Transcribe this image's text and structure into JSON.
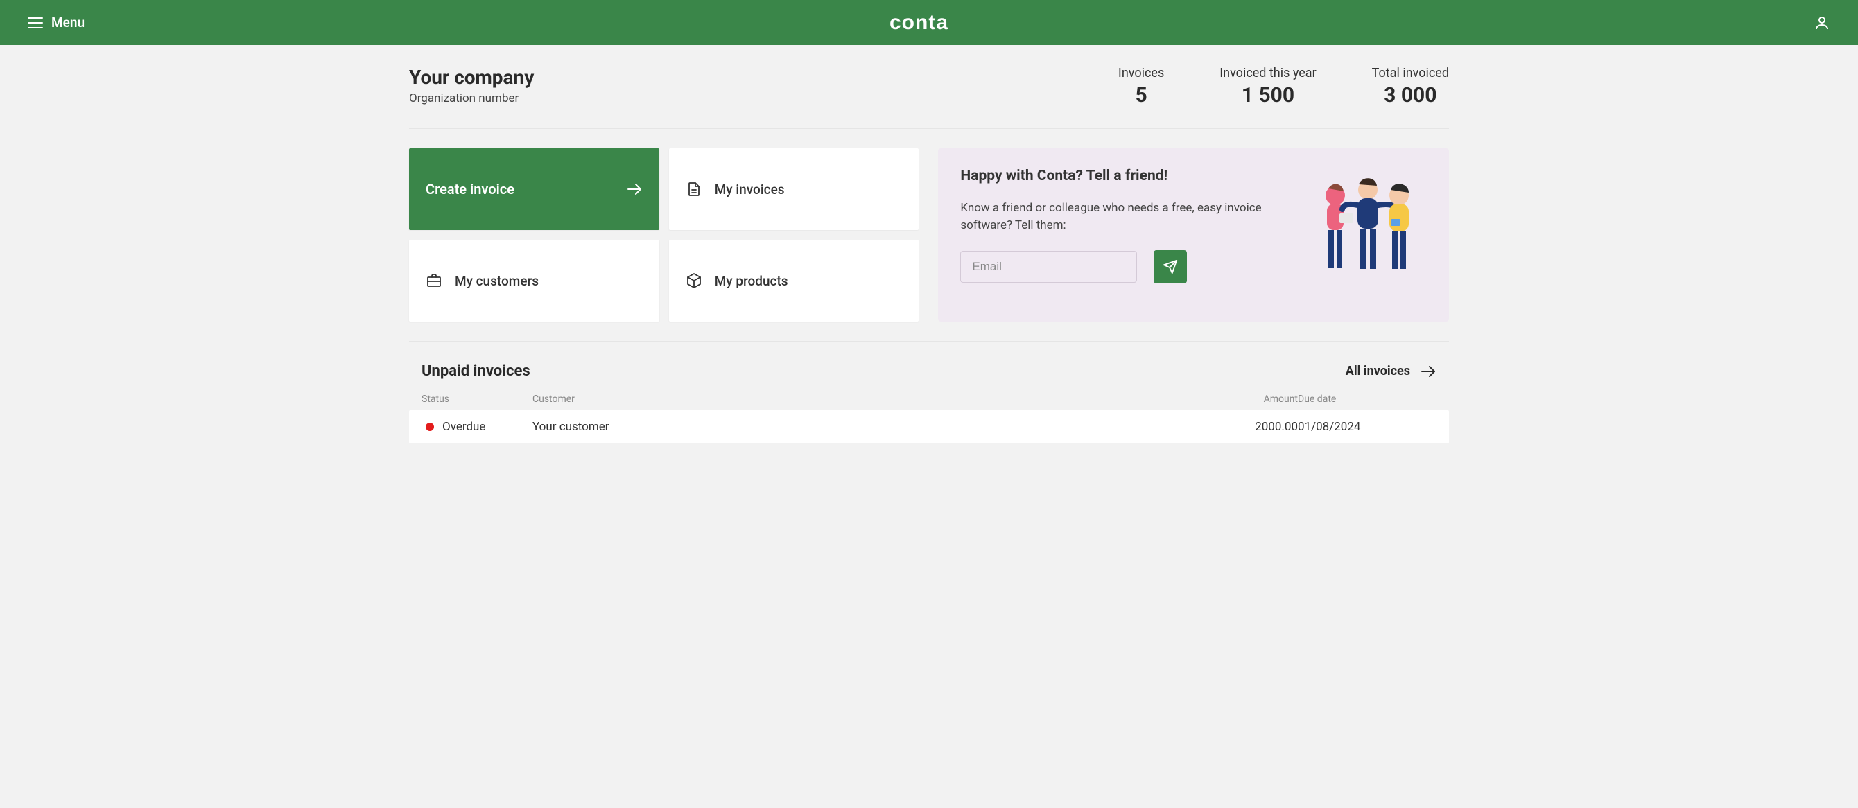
{
  "header": {
    "menu_label": "Menu",
    "logo_text": "conta"
  },
  "company": {
    "name": "Your company",
    "org_label": "Organization number"
  },
  "stats": {
    "invoices_label": "Invoices",
    "invoices_value": "5",
    "invoiced_year_label": "Invoiced this year",
    "invoiced_year_value": "1 500",
    "total_invoiced_label": "Total invoiced",
    "total_invoiced_value": "3 000"
  },
  "actions": {
    "create_invoice": "Create invoice",
    "my_invoices": "My invoices",
    "my_customers": "My customers",
    "my_products": "My products"
  },
  "referral": {
    "title": "Happy with Conta? Tell a friend!",
    "body": "Know a friend or colleague who needs a free, easy invoice software? Tell them:",
    "email_placeholder": "Email"
  },
  "invoices": {
    "section_title": "Unpaid invoices",
    "all_link": "All invoices",
    "columns": {
      "status": "Status",
      "customer": "Customer",
      "amount": "Amount",
      "due_date": "Due date"
    },
    "rows": [
      {
        "status": "Overdue",
        "status_color": "#e31c1c",
        "customer": "Your customer",
        "amount": "2000.00",
        "due_date": "01/08/2024"
      }
    ]
  },
  "colors": {
    "brand_green": "#3a8649",
    "referral_bg": "#f0e9f2"
  }
}
